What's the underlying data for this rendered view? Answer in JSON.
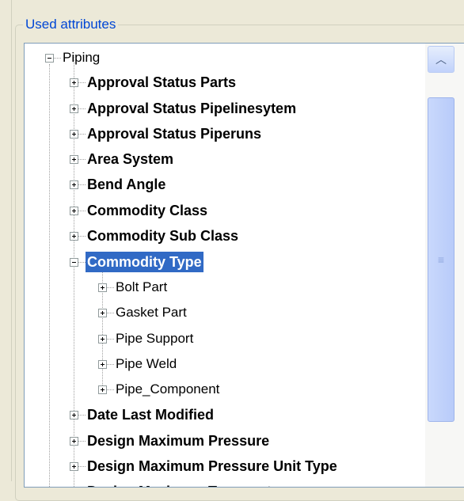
{
  "group": {
    "legend": "Used attributes"
  },
  "tree": {
    "root": "Piping",
    "attributes": [
      "Approval Status Parts",
      "Approval Status Pipelinesytem",
      "Approval Status Piperuns",
      "Area System",
      "Bend Angle",
      "Commodity Class",
      "Commodity Sub Class",
      "Commodity Type",
      "Date Last Modified",
      "Design Maximum Pressure",
      "Design Maximum Pressure Unit Type",
      "Design Maximum Temperature"
    ],
    "selected": "Commodity Type",
    "commodity_type_children": [
      "Bolt Part",
      "Gasket Part",
      "Pipe Support",
      "Pipe Weld",
      "Pipe_Component"
    ]
  },
  "scrollbar": {
    "up_icon": "chevron-up-icon",
    "grip_icon": "grip-lines-icon",
    "thumb_glyph": "≡",
    "up_glyph": "︿"
  },
  "colors": {
    "legend": "#0046d5",
    "selection": "#316ac5",
    "border": "#7f9db9"
  }
}
